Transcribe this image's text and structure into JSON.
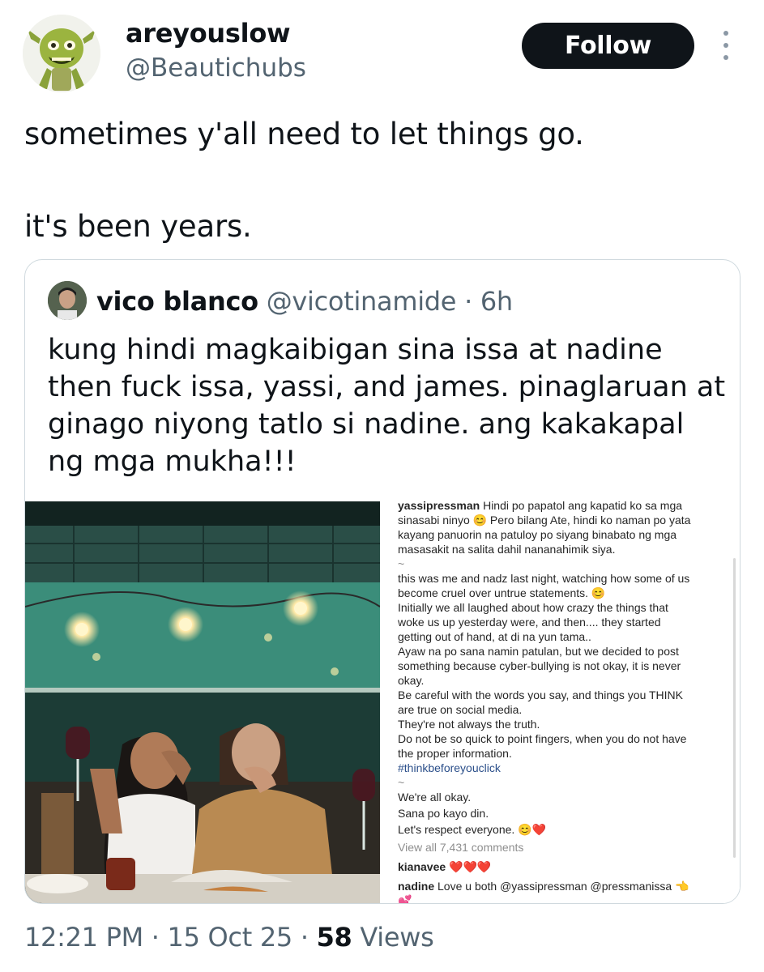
{
  "author": {
    "display_name": "areyouslow",
    "handle": "@Beautichubs",
    "follow_label": "Follow"
  },
  "tweet": {
    "line1": "sometimes y'all need to let things go.",
    "line2": "it's been years."
  },
  "quoted": {
    "display_name": "vico blanco",
    "handle": "@vicotinamide",
    "separator": "·",
    "time": "6h",
    "text": "kung hindi magkaibigan sina issa at nadine then fuck issa, yassi, and james. pinaglaruan at ginago niyong tatlo si nadine. ang kakakapal ng mga mukha!!!"
  },
  "screenshot_post": {
    "caption_user": "yassipressman",
    "caption_lines": [
      "Hindi po papatol ang kapatid ko sa mga",
      "sinasabi ninyo 😊 Pero bilang Ate, hindi ko naman po yata",
      "kayang panuorin na patuloy po siyang binabato ng mga",
      "masasakit na salita dahil nananahimik siya."
    ],
    "tilde1": "~",
    "body_lines": [
      "this was me and nadz last night, watching how some of us",
      "become cruel over untrue statements. 😊",
      "Initially we all laughed about how crazy the things that",
      "woke us up yesterday were, and then.... they started",
      "getting out of hand, at di na yun tama..",
      "Ayaw na po sana namin patulan, but we decided to post",
      "something because cyber-bullying is not okay, it is never",
      "okay.",
      "Be careful with the words you say, and things you THINK",
      "are true on social media.",
      "They're not always the truth.",
      "Do not be so quick to point fingers, when you do not have",
      "the proper information."
    ],
    "hashtag": "#thinkbeforeyouclick",
    "tilde2": "~",
    "closing_lines": [
      "We're all okay.",
      "Sana po kayo din.",
      "Let's respect everyone. 😊❤️"
    ],
    "view_comments": "View all 7,431 comments",
    "comment1_user": "kianavee",
    "comment1_text": "❤️❤️❤️",
    "comment2_user": "nadine",
    "comment2_text": "Love u both @yassipressman @pressmanissa",
    "comment2_emoji": "👈",
    "comment3_emoji": "💕"
  },
  "footer": {
    "time": "12:21 PM",
    "dot1": "·",
    "date": "15 Oct 25",
    "dot2": "·",
    "views_count": "58",
    "views_label": "Views"
  },
  "icons": {
    "more": "more-options-icon",
    "heart": "heart-outline-icon"
  }
}
